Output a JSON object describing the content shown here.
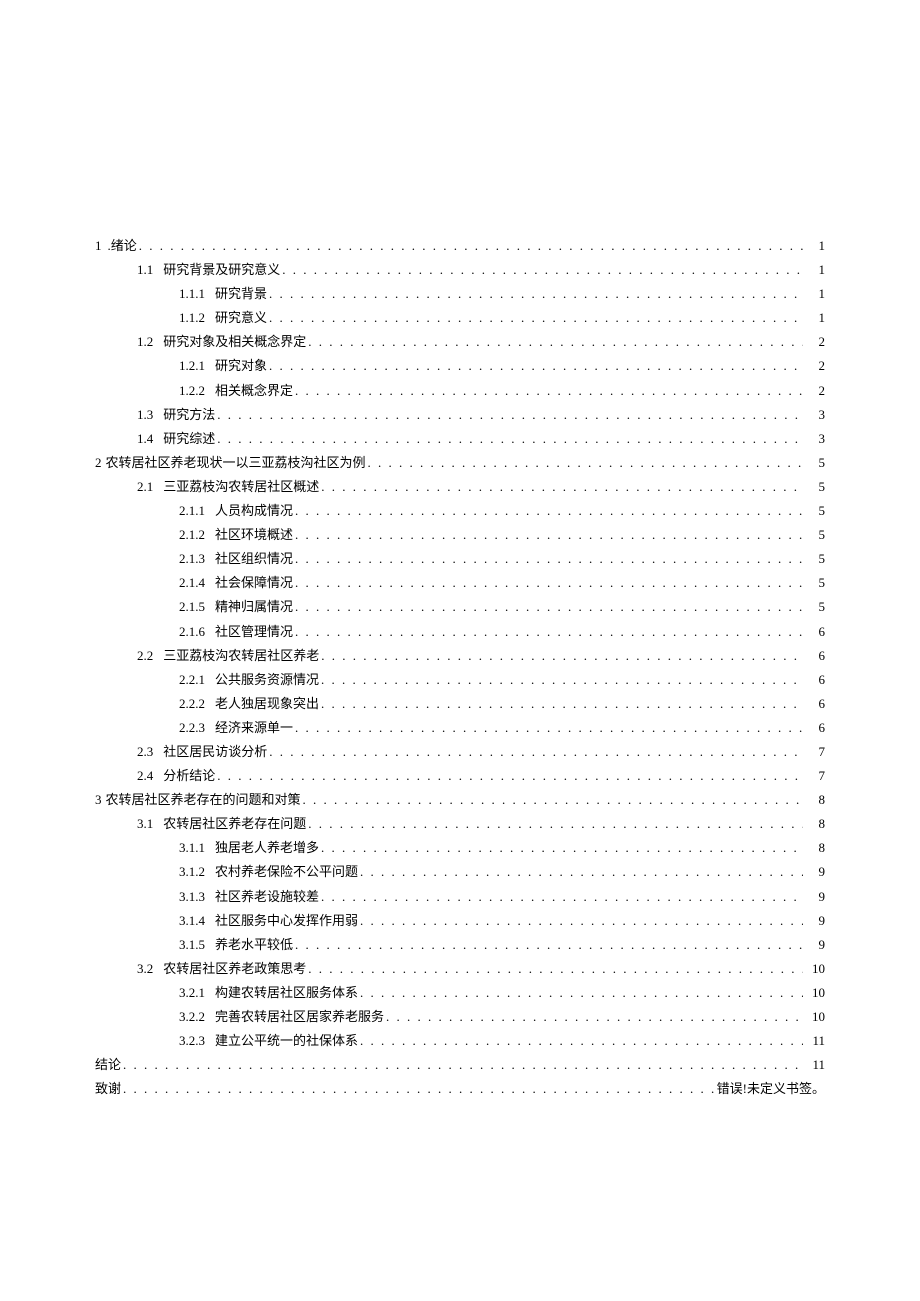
{
  "toc": [
    {
      "level": 1,
      "num": "1",
      "title": ".绪论",
      "page": "1",
      "nopad": true
    },
    {
      "level": 2,
      "num": "1.1",
      "title": "研究背景及研究意义",
      "page": "1"
    },
    {
      "level": 3,
      "num": "1.1.1",
      "title": "研究背景",
      "page": "1"
    },
    {
      "level": 3,
      "num": "1.1.2",
      "title": "研究意义",
      "page": "1"
    },
    {
      "level": 2,
      "num": "1.2",
      "title": "研究对象及相关概念界定",
      "page": "2"
    },
    {
      "level": 3,
      "num": "1.2.1",
      "title": "研究对象",
      "page": "2"
    },
    {
      "level": 3,
      "num": "1.2.2",
      "title": "相关概念界定",
      "page": "2"
    },
    {
      "level": 2,
      "num": "1.3",
      "title": "研究方法",
      "page": "3"
    },
    {
      "level": 2,
      "num": "1.4",
      "title": "研究综述",
      "page": "3"
    },
    {
      "level": 1,
      "num": "2",
      "title": "农转居社区养老现状一以三亚荔枝沟社区为例",
      "page": "5",
      "joined": true
    },
    {
      "level": 2,
      "num": "2.1",
      "title": "三亚荔枝沟农转居社区概述",
      "page": "5"
    },
    {
      "level": 3,
      "num": "2.1.1",
      "title": "人员构成情况",
      "page": "5"
    },
    {
      "level": 3,
      "num": "2.1.2",
      "title": "社区环境概述",
      "page": "5"
    },
    {
      "level": 3,
      "num": "2.1.3",
      "title": "社区组织情况",
      "page": "5"
    },
    {
      "level": 3,
      "num": "2.1.4",
      "title": "社会保障情况",
      "page": "5"
    },
    {
      "level": 3,
      "num": "2.1.5",
      "title": "精神归属情况",
      "page": "5"
    },
    {
      "level": 3,
      "num": "2.1.6",
      "title": "社区管理情况",
      "page": "6"
    },
    {
      "level": 2,
      "num": "2.2",
      "title": "三亚荔枝沟农转居社区养老",
      "page": "6"
    },
    {
      "level": 3,
      "num": "2.2.1",
      "title": "公共服务资源情况",
      "page": "6"
    },
    {
      "level": 3,
      "num": "2.2.2",
      "title": "老人独居现象突出",
      "page": "6"
    },
    {
      "level": 3,
      "num": "2.2.3",
      "title": "经济来源单一",
      "page": "6"
    },
    {
      "level": 2,
      "num": "2.3",
      "title": "社区居民访谈分析",
      "page": "7"
    },
    {
      "level": 2,
      "num": "2.4",
      "title": "分析结论",
      "page": "7"
    },
    {
      "level": 1,
      "num": "3",
      "title": "农转居社区养老存在的问题和对策",
      "page": "8",
      "joined": true
    },
    {
      "level": 2,
      "num": "3.1",
      "title": "农转居社区养老存在问题",
      "page": "8"
    },
    {
      "level": 3,
      "num": "3.1.1",
      "title": "独居老人养老增多",
      "page": "8"
    },
    {
      "level": 3,
      "num": "3.1.2",
      "title": "农村养老保险不公平问题",
      "page": "9"
    },
    {
      "level": 3,
      "num": "3.1.3",
      "title": "社区养老设施较差",
      "page": "9"
    },
    {
      "level": 3,
      "num": "3.1.4",
      "title": "社区服务中心发挥作用弱",
      "page": "9"
    },
    {
      "level": 3,
      "num": "3.1.5",
      "title": "养老水平较低",
      "page": "9"
    },
    {
      "level": 2,
      "num": "3.2",
      "title": "农转居社区养老政策思考",
      "page": "10"
    },
    {
      "level": 3,
      "num": "3.2.1",
      "title": "构建农转居社区服务体系",
      "page": "10"
    },
    {
      "level": 3,
      "num": "3.2.2",
      "title": "完善农转居社区居家养老服务",
      "page": "10"
    },
    {
      "level": 3,
      "num": "3.2.3",
      "title": "建立公平统一的社保体系",
      "page": "11"
    },
    {
      "level": 1,
      "num": "",
      "title": "结论",
      "page": "11"
    },
    {
      "level": 1,
      "num": "",
      "title": "致谢",
      "page": "错误!未定义书签。"
    }
  ]
}
